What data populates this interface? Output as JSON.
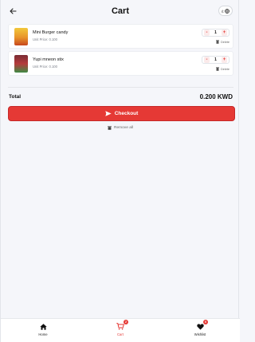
{
  "header": {
    "title": "Cart"
  },
  "items": [
    {
      "name": "Mini Burger candy",
      "price": "Unit Price: 0.100",
      "quantity": "1",
      "delete_label": "Delete"
    },
    {
      "name": "Yupi mneon stix",
      "price": "Unit Price: 0.100",
      "quantity": "1",
      "delete_label": "Delete"
    }
  ],
  "summary": {
    "total_label": "Total",
    "total_value": "0.200 KWD"
  },
  "actions": {
    "checkout_label": "Checkout",
    "remove_all_label": "Remove all"
  },
  "bottom_nav": {
    "home": {
      "label": "Home"
    },
    "cart": {
      "label": "Cart",
      "badge": "2"
    },
    "wishlist": {
      "label": "Wishlist",
      "badge": "0"
    }
  },
  "colors": {
    "accent": "#e53935",
    "background": "#f5f6fa"
  },
  "icons": [
    "back-arrow-icon",
    "language-icon",
    "trash-icon",
    "send-icon",
    "home-icon",
    "cart-icon",
    "heart-icon"
  ]
}
